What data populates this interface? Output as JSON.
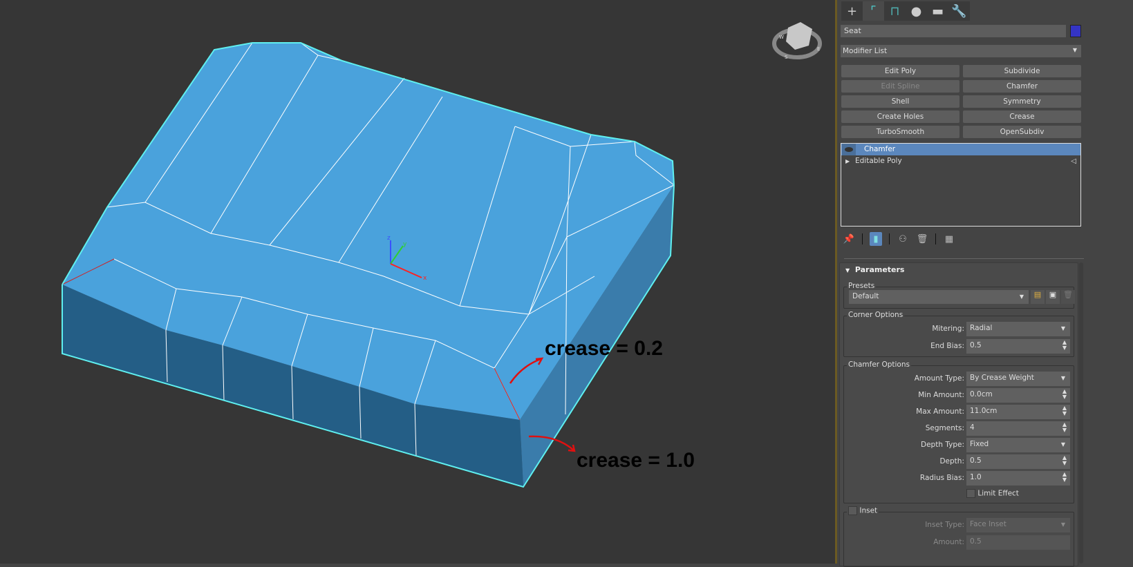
{
  "viewport": {
    "annotations": [
      "crease = 0.2",
      "crease = 1.0"
    ],
    "gizmo_axes": [
      "x",
      "y",
      "z"
    ],
    "viewcube": {
      "faces": [
        "TOP",
        "FRONT"
      ],
      "compass": [
        "W",
        "S",
        "E"
      ]
    },
    "colors": {
      "top_face": "#4aa2dc",
      "front_face": "#245e86",
      "side_face": "#3a7cab",
      "selection_outline": "#5ff0f0",
      "crease_edge": "#d22020"
    }
  },
  "command_panel": {
    "tabs": [
      {
        "icon": "plus-icon"
      },
      {
        "icon": "modify-icon",
        "active": true
      },
      {
        "icon": "hierarchy-icon"
      },
      {
        "icon": "motion-icon"
      },
      {
        "icon": "display-icon"
      },
      {
        "icon": "utilities-wrench-icon"
      }
    ],
    "object_name": "Seat",
    "object_color": "#3434c4",
    "modifier_list": "Modifier List",
    "modifier_buttons": [
      {
        "label": "Edit Poly"
      },
      {
        "label": "Subdivide"
      },
      {
        "label": "Edit Spline",
        "disabled": true
      },
      {
        "label": "Chamfer"
      },
      {
        "label": "Shell"
      },
      {
        "label": "Symmetry"
      },
      {
        "label": "Create Holes"
      },
      {
        "label": "Crease"
      },
      {
        "label": "TurboSmooth"
      },
      {
        "label": "OpenSubdiv"
      }
    ],
    "stack": [
      {
        "label": "Chamfer",
        "selected": true
      },
      {
        "label": "Editable Poly"
      }
    ],
    "parameters": {
      "title": "Parameters",
      "presets_label": "Presets",
      "preset": "Default",
      "corner_label": "Corner Options",
      "mitering_label": "Mitering:",
      "mitering": "Radial",
      "end_bias_label": "End Bias:",
      "end_bias": "0.5",
      "chamfer_label": "Chamfer Options",
      "amount_type_label": "Amount Type:",
      "amount_type": "By Crease Weight",
      "min_amount_label": "Min Amount:",
      "min_amount": "0.0cm",
      "max_amount_label": "Max Amount:",
      "max_amount": "11.0cm",
      "segments_label": "Segments:",
      "segments": "4",
      "depth_type_label": "Depth Type:",
      "depth_type": "Fixed",
      "depth_label": "Depth:",
      "depth": "0.5",
      "radius_bias_label": "Radius Bias:",
      "radius_bias": "1.0",
      "limit_effect_label": "Limit Effect",
      "limit_effect": false,
      "inset_label": "Inset",
      "inset": false,
      "inset_type_label": "Inset Type:",
      "inset_type": "Face Inset",
      "amount_label": "Amount:",
      "amount": "0.5"
    }
  }
}
